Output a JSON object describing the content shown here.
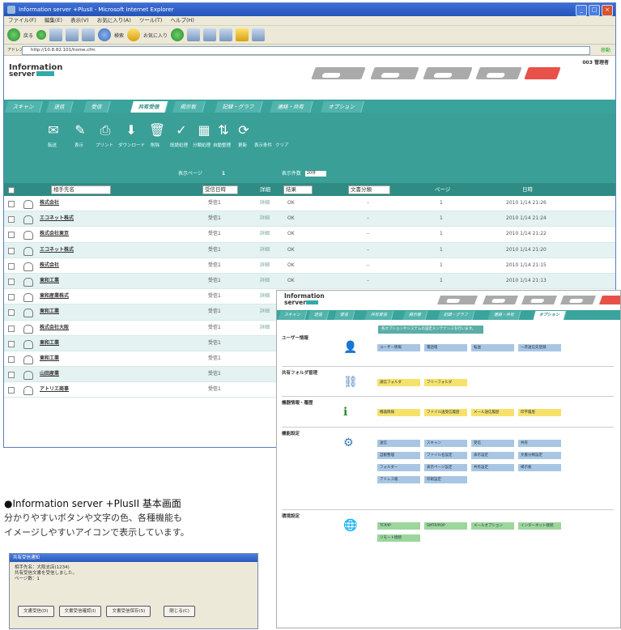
{
  "browser": {
    "title": "Information server +PlusII - Microsoft Internet Explorer",
    "menu": [
      "ファイル(F)",
      "編集(E)",
      "表示(V)",
      "お気に入り(A)",
      "ツール(T)",
      "ヘルプ(H)"
    ],
    "back_label": "戻る",
    "search_label": "検索",
    "favorites_label": "お気に入り",
    "address_label": "アドレス(D)",
    "address": "http://10.8.82.101/home.cfm",
    "go_label": "移動"
  },
  "app": {
    "logo_line1": "Information",
    "logo_line2": "server",
    "admin_label": "003 管理者",
    "status_on": "ON"
  },
  "tabs": [
    "スキャン",
    "送信",
    "受信",
    "共有受信",
    "掲示板",
    "記録・グラフ",
    "連絡・共有",
    "オプション"
  ],
  "active_tab": 3,
  "actions": [
    "転送",
    "表示",
    "プリント",
    "ダウンロード",
    "削除",
    "既読処理",
    "分類処理",
    "自動整理",
    "更新",
    "表示条件",
    "クリア"
  ],
  "paging": {
    "page_label": "表示ページ",
    "page": "1",
    "per_page_label": "表示件数",
    "per_page": "20件"
  },
  "columns": {
    "sender": "相手先名",
    "send_time": "受信日時",
    "detail": "詳細",
    "status": "結果",
    "category": "文書分類",
    "pages": "ページ",
    "date": "日時"
  },
  "rows": [
    {
      "icon": "fax-icon",
      "name": "株式会社",
      "time": "受信1",
      "detail": "詳細",
      "result": "OK",
      "category": "–",
      "pages": "1",
      "date": "2010 1/14 21:26"
    },
    {
      "icon": "user-icon",
      "name": "エコネット株式",
      "time": "受信1",
      "detail": "詳細",
      "result": "OK",
      "category": "–",
      "pages": "1",
      "date": "2010 1/14 21:24"
    },
    {
      "icon": "user-icon",
      "name": "株式会社東京",
      "time": "受信1",
      "detail": "詳細",
      "result": "OK",
      "category": "–",
      "pages": "1",
      "date": "2010 1/14 21:22"
    },
    {
      "icon": "user-icon",
      "name": "エコネット株式",
      "time": "受信1",
      "detail": "詳細",
      "result": "OK",
      "category": "–",
      "pages": "1",
      "date": "2010 1/14 21:20"
    },
    {
      "icon": "fax-icon",
      "name": "株式会社",
      "time": "受信1",
      "detail": "詳細",
      "result": "OK",
      "category": "–",
      "pages": "1",
      "date": "2010 1/14 21:15"
    },
    {
      "icon": "user-icon",
      "name": "東和工業",
      "time": "受信1",
      "detail": "詳細",
      "result": "OK",
      "category": "–",
      "pages": "1",
      "date": "2010 1/14 21:13"
    },
    {
      "icon": "user-icon",
      "name": "東和産業株式",
      "time": "受信1",
      "detail": "詳細",
      "result": "OK",
      "category": "–",
      "pages": "1",
      "date": "2010 1/14 21:07"
    },
    {
      "icon": "user-icon",
      "name": "東和工業",
      "time": "受信1",
      "detail": "詳細",
      "result": "OK",
      "category": "–",
      "pages": "1",
      "date": "2010 1/14 21:06"
    },
    {
      "icon": "user-icon",
      "name": "株式会社大阪",
      "time": "受信1",
      "detail": "詳細",
      "result": "–",
      "category": "–",
      "pages": "1",
      "date": "2010 1/14 21:00"
    },
    {
      "icon": "user-icon",
      "name": "東和工業",
      "time": "受信1",
      "detail": "",
      "result": "",
      "category": "",
      "pages": "",
      "date": ""
    },
    {
      "icon": "user-icon",
      "name": "東和工業",
      "time": "受信1",
      "detail": "",
      "result": "",
      "category": "",
      "pages": "",
      "date": ""
    },
    {
      "icon": "user-icon",
      "name": "山田産業",
      "time": "受信1",
      "detail": "",
      "result": "",
      "category": "",
      "pages": "",
      "date": ""
    },
    {
      "icon": "user-icon",
      "name": "アトリエ商事",
      "time": "受信1",
      "detail": "",
      "result": "",
      "category": "",
      "pages": "",
      "date": ""
    }
  ],
  "caption": {
    "title": "●Information server +PlusII 基本画面",
    "line1": "分かりやすいボタンや文字の色、各種機能も",
    "line2": "イメージしやすいアイコンで表示しています。"
  },
  "dialog": {
    "title": "共有受信通知",
    "line1": "相手先名：大阪支店(1234)",
    "line2": "共有受信文書を受信しました。",
    "line3": "ページ数：1",
    "buttons": [
      "文書受信(D)",
      "文書受信確認(I)",
      "文書受信保存(S)",
      "閉じる(C)"
    ]
  },
  "options": {
    "logo_line1": "Information",
    "logo_line2": "server",
    "tabs": [
      "スキャン",
      "送信",
      "受信",
      "共有受信",
      "掲示板",
      "記録・グラフ",
      "連絡・共有",
      "オプション"
    ],
    "banner": "各オプションやシステムの設定メンテナンスを行います。",
    "sections": [
      {
        "title": "ユーザー情報",
        "chips": [
          "ユーザー情報",
          "電話帳",
          "転送",
          "一斉送信先登録"
        ],
        "color": "blue"
      },
      {
        "title": "共有フォルダ管理",
        "chips": [
          "通信フォルダ",
          "フリーフォルダ"
        ],
        "color": "yel"
      },
      {
        "title": "機器情報・履歴",
        "chips": [
          "機器情報",
          "ファイル送受信履歴",
          "メール送信履歴",
          "印字履歴"
        ],
        "color": "yel"
      },
      {
        "title": "機能設定",
        "chips": [
          "送信",
          "スキャン",
          "受信",
          "共有",
          "自動整理",
          "ファイル名設定",
          "表示設定",
          "文書分類設定",
          "フォルダー",
          "表示ページ設定",
          "共有設定",
          "掲示板",
          "アドレス帳",
          "印刷設定"
        ],
        "color": "blue"
      },
      {
        "title": "環境設定",
        "chips": [
          "TCP/IP",
          "SMTP/POP",
          "メールオプション",
          "インターネット接続",
          "リモート接続"
        ],
        "color": "grn"
      }
    ]
  }
}
